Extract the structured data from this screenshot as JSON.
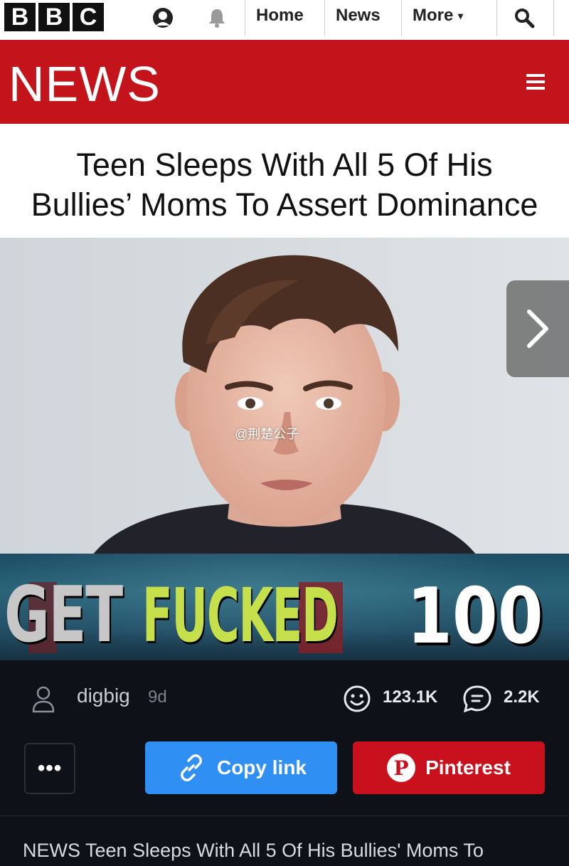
{
  "brand": {
    "logo_letters": [
      "B",
      "B",
      "C"
    ],
    "accent": "#c4141b"
  },
  "nav": {
    "home": "Home",
    "news": "News",
    "more": "More"
  },
  "banner": {
    "title": "NEWS"
  },
  "article": {
    "headline": "Teen Sleeps With All 5 Of His\nBullies’ Moms To Assert Dominance",
    "watermark": "@荆楚公子"
  },
  "meme": {
    "word1": "GET",
    "word2": "FUCKED",
    "score": "100"
  },
  "post": {
    "username": "digbig",
    "age": "9d",
    "reactions": "123.1K",
    "comments": "2.2K"
  },
  "actions": {
    "more": "•••",
    "copy_link": "Copy link",
    "pinterest": "Pinterest",
    "pinterest_glyph": "P",
    "copy_color": "#2f8ff2",
    "pinterest_color": "#c8111c"
  },
  "footer": {
    "caption": "NEWS Teen Sleeps With All 5 Of His Bullies' Moms To"
  }
}
